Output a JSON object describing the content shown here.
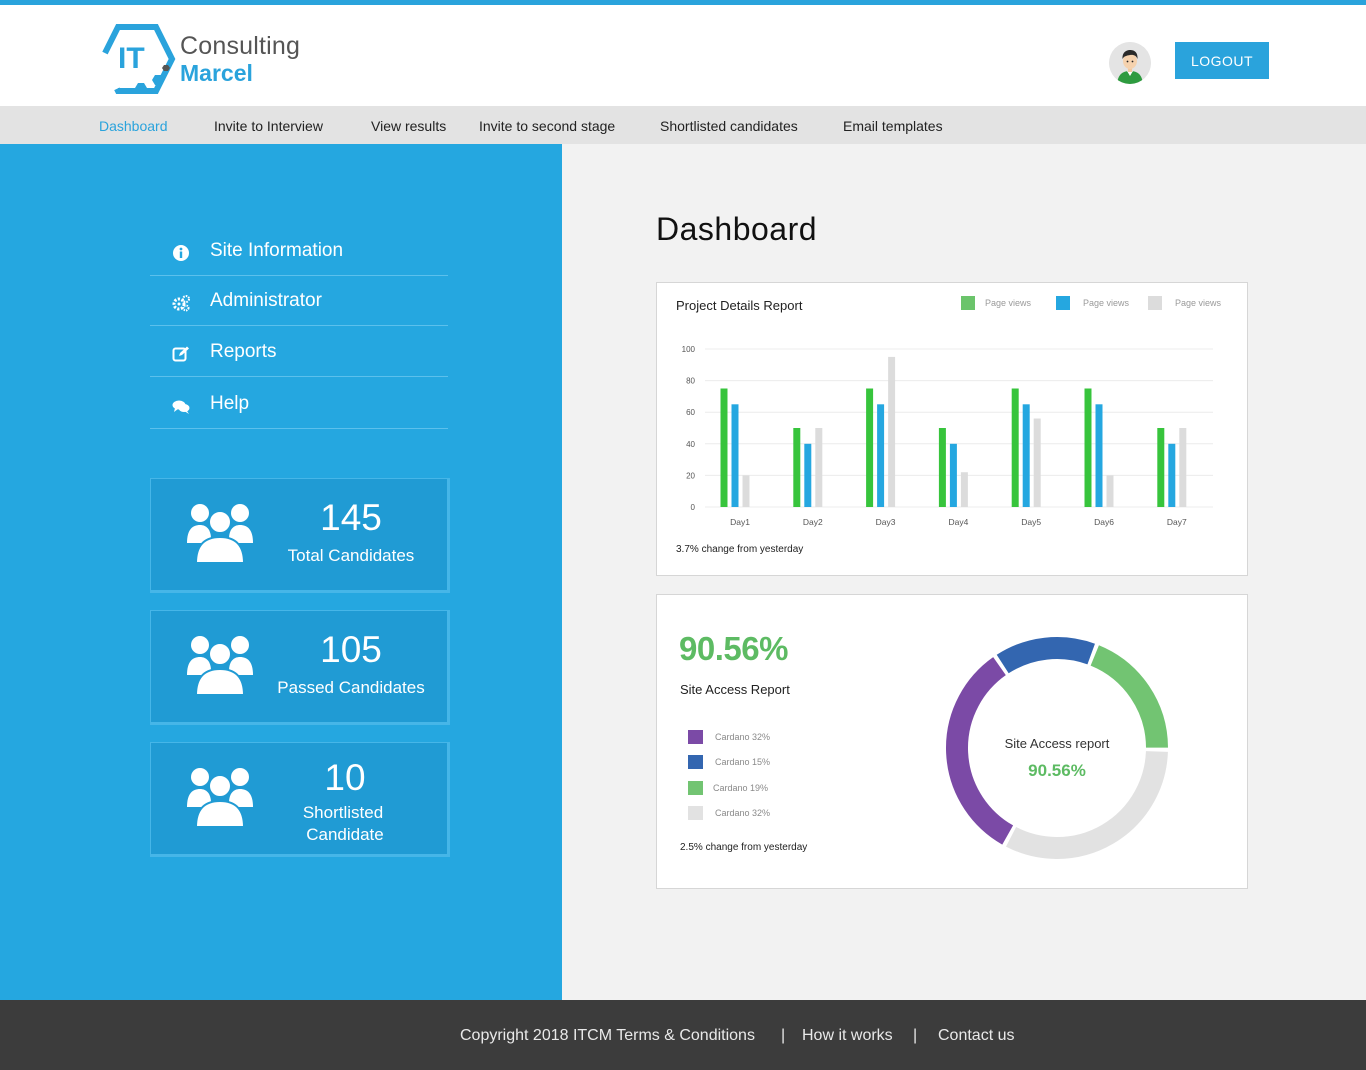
{
  "header": {
    "logo": {
      "mark": "IT",
      "line1": "Consulting",
      "line2": "Marcel"
    },
    "logout_label": "LOGOUT"
  },
  "nav": {
    "items": [
      {
        "label": "Dashboard",
        "active": true
      },
      {
        "label": "Invite to Interview",
        "active": false
      },
      {
        "label": "View results",
        "active": false
      },
      {
        "label": "Invite to second stage",
        "active": false
      },
      {
        "label": "Shortlisted candidates",
        "active": false
      },
      {
        "label": "Email templates",
        "active": false
      }
    ]
  },
  "sidebar": {
    "menu": [
      {
        "label": "Site Information",
        "icon": "info-icon"
      },
      {
        "label": "Administrator",
        "icon": "gears-icon"
      },
      {
        "label": "Reports",
        "icon": "edit-icon"
      },
      {
        "label": "Help",
        "icon": "chat-icon"
      }
    ],
    "stats": [
      {
        "value": "145",
        "label": "Total Candidates",
        "icon": "users-icon"
      },
      {
        "value": "105",
        "label": "Passed Candidates",
        "icon": "users-icon"
      },
      {
        "value": "10",
        "label_line1": "Shortlisted",
        "label_line2": "Candidate",
        "icon": "users-icon"
      }
    ]
  },
  "main": {
    "title": "Dashboard",
    "project_report": {
      "title": "Project Details Report",
      "note": "3.7% change from yesterday"
    },
    "site_access": {
      "percent": "90.56%",
      "title": "Site Access Report",
      "legend": [
        {
          "label": "Cardano 32%",
          "color": "#7b4aa6"
        },
        {
          "label": "Cardano 15%",
          "color": "#3366b0"
        },
        {
          "label": "Cardano 19%",
          "color": "#72c472"
        },
        {
          "label": "Cardano 32%",
          "color": "#e2e2e2"
        }
      ],
      "donut_label": "Site Access report",
      "donut_percent": "90.56%",
      "note": "2.5% change from yesterday"
    }
  },
  "chart_data": [
    {
      "type": "bar",
      "title": "Project Details Report",
      "categories": [
        "Day1",
        "Day2",
        "Day3",
        "Day4",
        "Day5",
        "Day6",
        "Day7"
      ],
      "series": [
        {
          "name": "Page views",
          "color": "#37c43c",
          "values": [
            75,
            50,
            75,
            50,
            75,
            75,
            50
          ]
        },
        {
          "name": "Page views",
          "color": "#25a7e0",
          "values": [
            65,
            40,
            65,
            40,
            65,
            65,
            40
          ]
        },
        {
          "name": "Page views",
          "color": "#dcdcdc",
          "values": [
            20,
            50,
            95,
            22,
            56,
            20,
            50
          ]
        }
      ],
      "yticks": [
        0,
        20,
        40,
        60,
        80,
        100
      ],
      "ylim": [
        0,
        100
      ],
      "legend_position": "top-right",
      "grid": true
    },
    {
      "type": "pie",
      "title": "Site Access report",
      "slices": [
        {
          "label": "Cardano 15%",
          "value": 15,
          "color": "#3366b0"
        },
        {
          "label": "Cardano 19%",
          "value": 19,
          "color": "#72c472"
        },
        {
          "label": "Cardano 32%",
          "value": 32,
          "color": "#e2e2e2"
        },
        {
          "label": "Cardano 32%",
          "value": 32,
          "color": "#7b4aa6"
        }
      ],
      "center_text": "90.56%"
    }
  ],
  "footer": {
    "copyright": "Copyright 2018 ITCM Terms & Conditions",
    "how_it_works": "How it works",
    "contact": "Contact us",
    "separator": "|"
  }
}
